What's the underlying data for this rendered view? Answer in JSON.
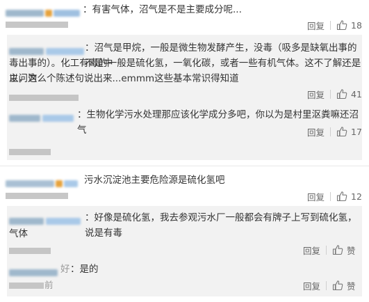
{
  "comments": [
    {
      "text": "：有害气体，沼气是不是主要成分呢...",
      "reply_label": "回复",
      "like_count": "18"
    }
  ],
  "replies_1": [
    {
      "text_line1": "：沼气是甲烷，一般是微生物发酵产生，没毒（吸多是缺氧出事的不是中",
      "text_line2": "毒出事的）。化工有毒的一般是硫化氢，一氧化碳，或者一些有机气体。这不了解还是以问为",
      "text_line3": "主，这么个陈述句说出来...emmm这些基本常识得知道",
      "reply_label": "回复",
      "like_count": "41"
    },
    {
      "text": "：生物化学污水处理那应该化学成分多吧，你以为是村里沤粪嘛还沼气",
      "reply_label": "回复",
      "like_count": "17"
    }
  ],
  "comment2": {
    "text": "污水沉淀池主要危险源是硫化氢吧",
    "reply_label": "回复",
    "like_count": "12"
  },
  "replies_2": [
    {
      "text_line1": "：好像是硫化氢，我去参观污水厂一般都会有牌子上写到硫化氢，说是有毒",
      "text_line2": "气体",
      "reply_label": "回复",
      "like_label": "赞"
    },
    {
      "name_tail": "好",
      "text": "：是的",
      "time_tail": "前",
      "reply_label": "回复",
      "like_label": "赞"
    }
  ],
  "colors": {
    "reply_bg": "#f2f2f2",
    "text": "#333333",
    "meta": "#666666",
    "divider": "#e8e8e8"
  }
}
